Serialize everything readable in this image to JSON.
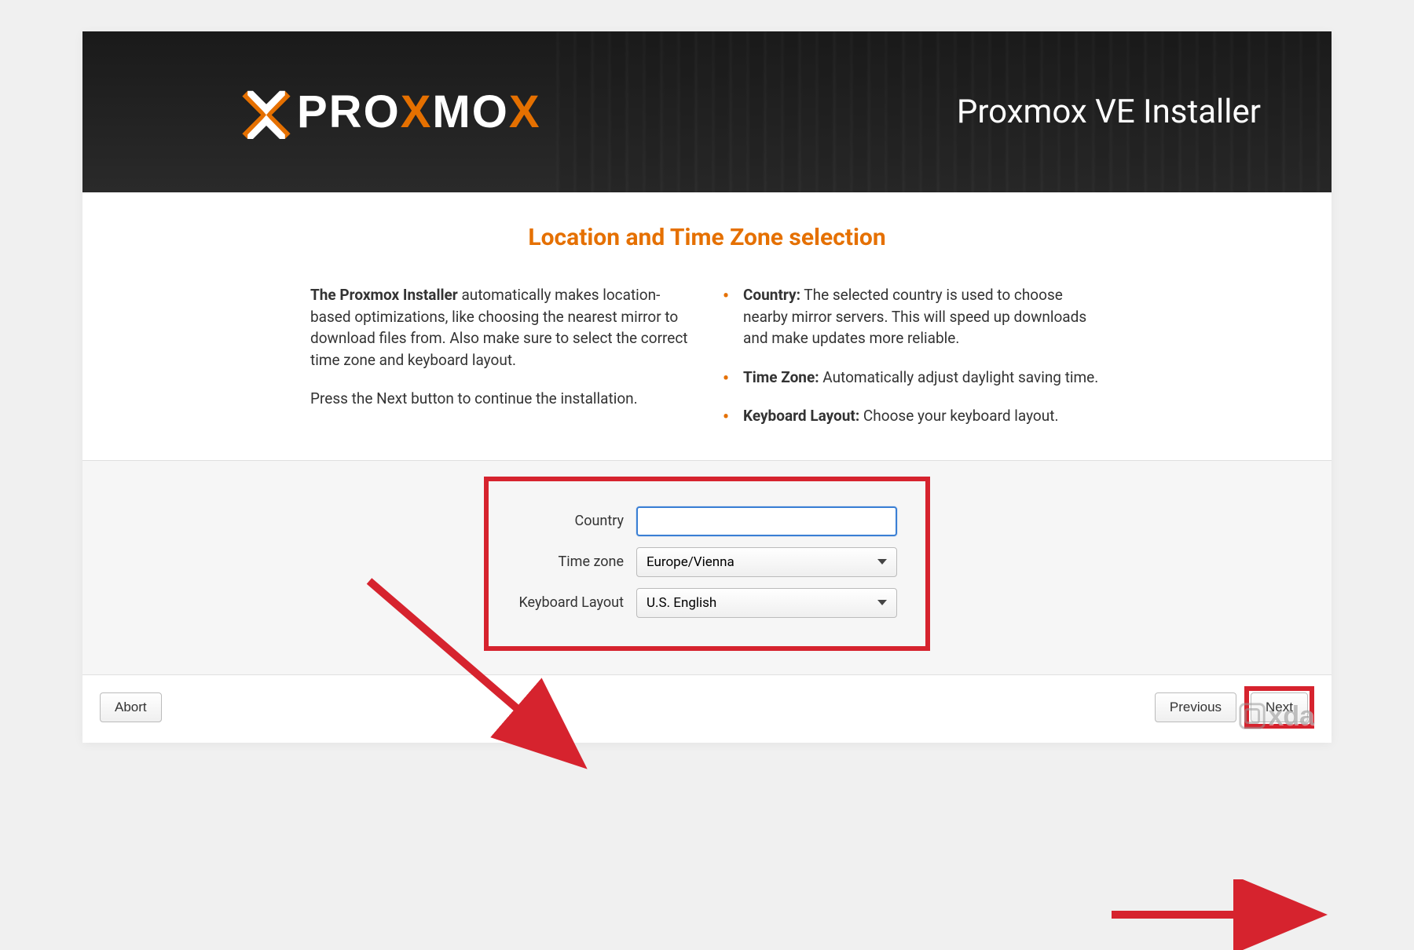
{
  "header": {
    "brand": "PROXMOX",
    "title": "Proxmox VE Installer"
  },
  "page": {
    "title": "Location and Time Zone selection"
  },
  "intro": {
    "bold": "The Proxmox Installer",
    "p1_rest": " automatically makes location-based optimizations, like choosing the nearest mirror to download files from. Also make sure to select the correct time zone and keyboard layout.",
    "p2": "Press the Next button to continue the installation."
  },
  "bullets": {
    "country_label": "Country:",
    "country_text": " The selected country is used to choose nearby mirror servers. This will speed up downloads and make updates more reliable.",
    "tz_label": "Time Zone:",
    "tz_text": " Automatically adjust daylight saving time.",
    "kb_label": "Keyboard Layout:",
    "kb_text": " Choose your keyboard layout."
  },
  "form": {
    "country_label": "Country",
    "country_value": "",
    "tz_label": "Time zone",
    "tz_value": "Europe/Vienna",
    "kb_label": "Keyboard Layout",
    "kb_value": "U.S. English"
  },
  "buttons": {
    "abort": "Abort",
    "previous": "Previous",
    "next": "Next"
  },
  "watermark": {
    "text": "xda"
  },
  "colors": {
    "accent": "#e57000",
    "highlight": "#d6232e",
    "focus": "#3a7fd4"
  }
}
